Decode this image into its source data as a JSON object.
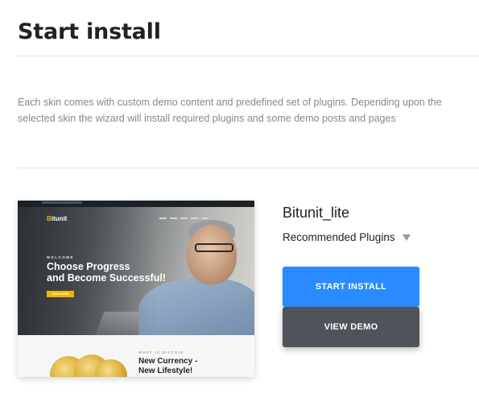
{
  "page": {
    "title": "Start install",
    "description": "Each skin comes with custom demo content and predefined set of plugins. Depending upon the selected skin the wizard will install required plugins and some demo posts and pages"
  },
  "skin": {
    "name": "Bitunit_lite",
    "plugins_label": "Recommended Plugins",
    "preview": {
      "logo_mark": "B",
      "logo_text": "itunit",
      "welcome": "WELCOME",
      "headline_line1": "Choose Progress",
      "headline_line2": "and Become Successful!",
      "hero_button": "READ MORE",
      "what_is": "WHAT IS BITCOIN",
      "currency_line1": "New Currency -",
      "currency_line2": "New Lifestyle!"
    }
  },
  "buttons": {
    "install_label": "START INSTALL",
    "demo_label": "VIEW DEMO"
  },
  "colors": {
    "install_button": "#2a8bfe",
    "demo_button": "#4f535a",
    "preview_accent": "#f4b400"
  }
}
